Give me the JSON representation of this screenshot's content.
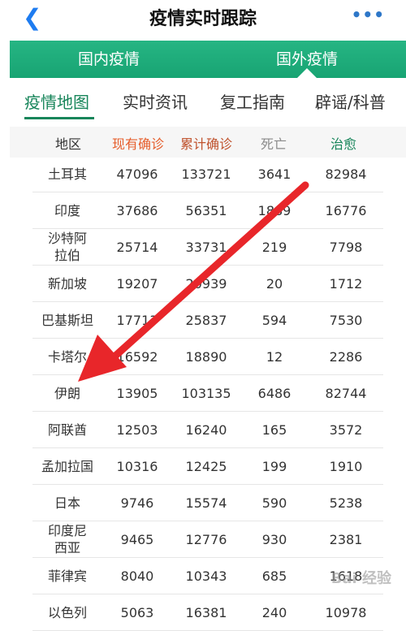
{
  "header": {
    "back_icon": "chevron-left-icon",
    "title": "疫情实时跟踪",
    "more_icon": "more-dots-icon"
  },
  "segments": {
    "domestic": "国内疫情",
    "foreign": "国外疫情"
  },
  "subtabs": [
    "疫情地图",
    "实时资讯",
    "复工指南",
    "辟谣/科普"
  ],
  "table": {
    "headers": [
      "地区",
      "现有确诊",
      "累计确诊",
      "死亡",
      "治愈"
    ],
    "rows": [
      [
        "土耳其",
        "47096",
        "133721",
        "3641",
        "82984"
      ],
      [
        "印度",
        "37686",
        "56351",
        "1889",
        "16776"
      ],
      [
        "沙特阿拉伯",
        "25714",
        "33731",
        "219",
        "7798"
      ],
      [
        "新加坡",
        "19207",
        "20939",
        "20",
        "1712"
      ],
      [
        "巴基斯坦",
        "17713",
        "25837",
        "594",
        "7530"
      ],
      [
        "卡塔尔",
        "16592",
        "18890",
        "12",
        "2286"
      ],
      [
        "伊朗",
        "13905",
        "103135",
        "6486",
        "82744"
      ],
      [
        "阿联酋",
        "12503",
        "16240",
        "165",
        "3572"
      ],
      [
        "孟加拉国",
        "10316",
        "12425",
        "199",
        "1910"
      ],
      [
        "日本",
        "9746",
        "15574",
        "590",
        "5238"
      ],
      [
        "印度尼西亚",
        "9465",
        "12776",
        "930",
        "2381"
      ],
      [
        "菲律宾",
        "8040",
        "10343",
        "685",
        "1618"
      ],
      [
        "以色列",
        "5063",
        "16381",
        "240",
        "10978"
      ]
    ]
  },
  "colors": {
    "green": "#17855a",
    "current": "#e65e2c",
    "total": "#c0532e",
    "death": "#8a8a8a",
    "cured": "#17855a",
    "arrow": "#e8262a"
  },
  "watermark": "Bai 经验"
}
